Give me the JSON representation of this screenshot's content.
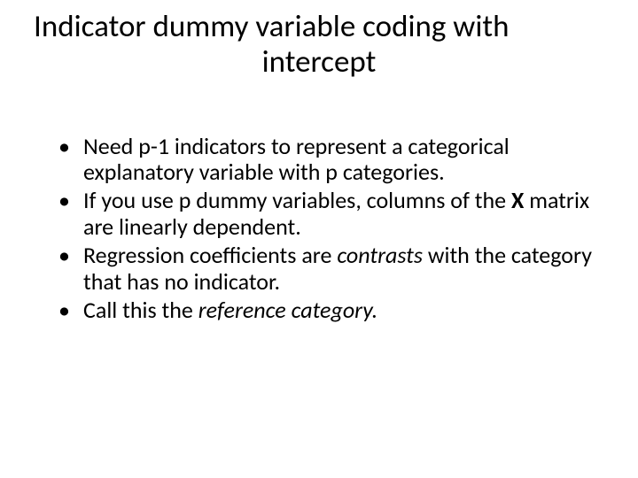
{
  "title": {
    "line1": "Indicator dummy variable coding with",
    "line2": "intercept"
  },
  "bullets": [
    {
      "pre": "Need p-1 indicators to represent a categorical explanatory variable with p categories."
    },
    {
      "pre": "If you use p dummy variables, columns of the ",
      "bold": "X",
      "post": " matrix are linearly dependent."
    },
    {
      "pre": "Regression coefficients are ",
      "italic": "contrasts",
      "post": " with the category that has no indicator."
    },
    {
      "pre": "Call this the ",
      "italic": "reference category."
    }
  ]
}
